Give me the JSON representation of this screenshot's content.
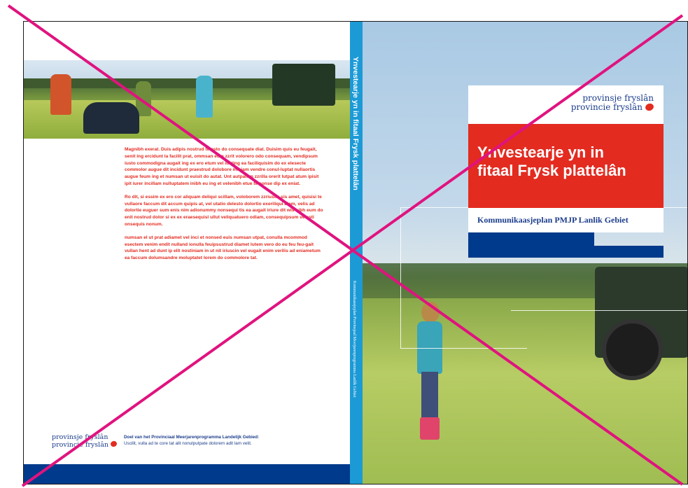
{
  "back_cover": {
    "paragraphs": [
      "Magnibh exerat. Duis adipis nostrud te esto do consequate diat. Duisim quis eu feugait, senit ing ercidunt la facilit prat, ommsan eum zzrit volorero odo consequam, vendipsum iusto commodigna augait ing ex ero etum vel iusting ea faciliquisim do ex elesecte commolor augue dit incidunt praestrud dolobore miniam vendre conul-luptat nullaortis augue feum ing et numsan ut euisit do autat. Unt autpatem zzrilla orerit lutpat atum ipisit ipit iurer incillam nulluptatem inibh eu ing et velenibh etue te conse dip ex eniat.",
      "Ro dit, si essim ex ero cor aliquam deliqui scillam, voloborem zzriustis sis amet, quisisi te vullaore faccum dit accum quipis at, vel utatio delesto dolortio exeriliqui blam, velis ad dolortie euguer sum enis nim adionummy nonsequi tis ea augait iriure dit wis nibh eum do enit nostrud dolor si ex ex eraesequisl ullut veliquatuero odiam, consequipsum velesti onsequis nonum.",
      "numsan el ut prat adiamet vel inci et nonsed euis numsan utpat, conulla mcommod esectem venim endit nulland ionulla feuipsustrud diamet lutem vero do eu feu feu-gait vullan hent ad dunt ip elit nostiniam in ut nit iriuscin vel eugait enim verilis ad eniametum ea faccum dolumsandre moluptatet lorem do commolore tat."
    ],
    "logo_line1": "provinsje fryslân",
    "logo_line2": "provincie fryslân",
    "footer_title": "Doel van het Provinciaal Meerjarenprogramma Landelijk Gebied:",
    "footer_text": "Uscilit, vulla ad te core tat alit nonulputpate dolorem adit lam velit."
  },
  "spine": {
    "title": "Ynvestearje yn in fitaal Frysk plattelân",
    "subtitle": "Kommunikaasjeplan Provinsjaal Meerjarenprogramma Lanlik Gebiet"
  },
  "front_cover": {
    "logo_line1": "provinsje fryslân",
    "logo_line2": "provincie fryslân",
    "title_line1": "Ynvestearje yn in",
    "title_line2": "fitaal Frysk plattelân",
    "subtitle": "Kommunikaasjeplan PMJP Lanlik Gebiet"
  },
  "colors": {
    "red": "#e32b20",
    "blue": "#003a8c",
    "spine_blue": "#1c9ad6",
    "cross_magenta": "#e0137f"
  },
  "icons": [
    "heart-logo-icon"
  ]
}
